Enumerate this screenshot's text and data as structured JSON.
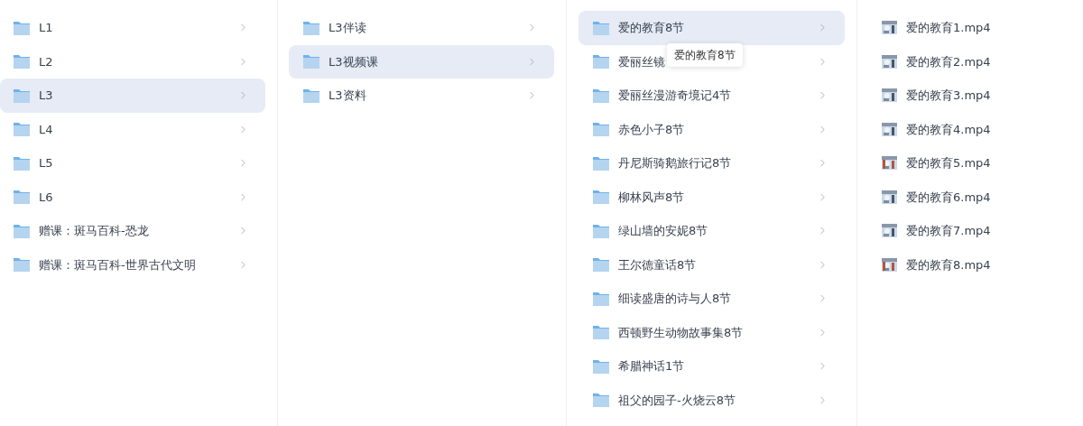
{
  "columns": [
    {
      "items": [
        {
          "kind": "folder",
          "label": "L1",
          "selected": false
        },
        {
          "kind": "folder",
          "label": "L2",
          "selected": false
        },
        {
          "kind": "folder",
          "label": "L3",
          "selected": true
        },
        {
          "kind": "folder",
          "label": "L4",
          "selected": false
        },
        {
          "kind": "folder",
          "label": "L5",
          "selected": false
        },
        {
          "kind": "folder",
          "label": "L6",
          "selected": false
        },
        {
          "kind": "folder",
          "label": "赠课：斑马百科-恐龙",
          "selected": false
        },
        {
          "kind": "folder",
          "label": "赠课：斑马百科-世界古代文明",
          "selected": false
        }
      ]
    },
    {
      "items": [
        {
          "kind": "folder",
          "label": "L3伴读",
          "selected": false
        },
        {
          "kind": "folder",
          "label": "L3视频课",
          "selected": true
        },
        {
          "kind": "folder",
          "label": "L3资料",
          "selected": false
        }
      ]
    },
    {
      "items": [
        {
          "kind": "folder",
          "label": "爱的教育8节",
          "selected": true
        },
        {
          "kind": "folder",
          "label": "爱丽丝镜",
          "selected": false
        },
        {
          "kind": "folder",
          "label": "爱丽丝漫游奇境记4节",
          "selected": false
        },
        {
          "kind": "folder",
          "label": "赤色小子8节",
          "selected": false
        },
        {
          "kind": "folder",
          "label": "丹尼斯骑鹅旅行记8节",
          "selected": false
        },
        {
          "kind": "folder",
          "label": "柳林风声8节",
          "selected": false
        },
        {
          "kind": "folder",
          "label": "绿山墙的安妮8节",
          "selected": false
        },
        {
          "kind": "folder",
          "label": "王尔德童话8节",
          "selected": false
        },
        {
          "kind": "folder",
          "label": "细读盛唐的诗与人8节",
          "selected": false
        },
        {
          "kind": "folder",
          "label": "西顿野生动物故事集8节",
          "selected": false
        },
        {
          "kind": "folder",
          "label": "希腊神话1节",
          "selected": false
        },
        {
          "kind": "folder",
          "label": "祖父的园子-火烧云8节",
          "selected": false
        }
      ]
    },
    {
      "items": [
        {
          "kind": "video",
          "label": "爱的教育1.mp4",
          "selected": false
        },
        {
          "kind": "video",
          "label": "爱的教育2.mp4",
          "selected": false
        },
        {
          "kind": "video",
          "label": "爱的教育3.mp4",
          "selected": false
        },
        {
          "kind": "video",
          "label": "爱的教育4.mp4",
          "selected": false
        },
        {
          "kind": "video",
          "label": "爱的教育5.mp4",
          "selected": false
        },
        {
          "kind": "video",
          "label": "爱的教育6.mp4",
          "selected": false
        },
        {
          "kind": "video",
          "label": "爱的教育7.mp4",
          "selected": false
        },
        {
          "kind": "video",
          "label": "爱的教育8.mp4",
          "selected": false
        }
      ]
    }
  ],
  "tooltip": {
    "text": "爱的教育8节"
  }
}
